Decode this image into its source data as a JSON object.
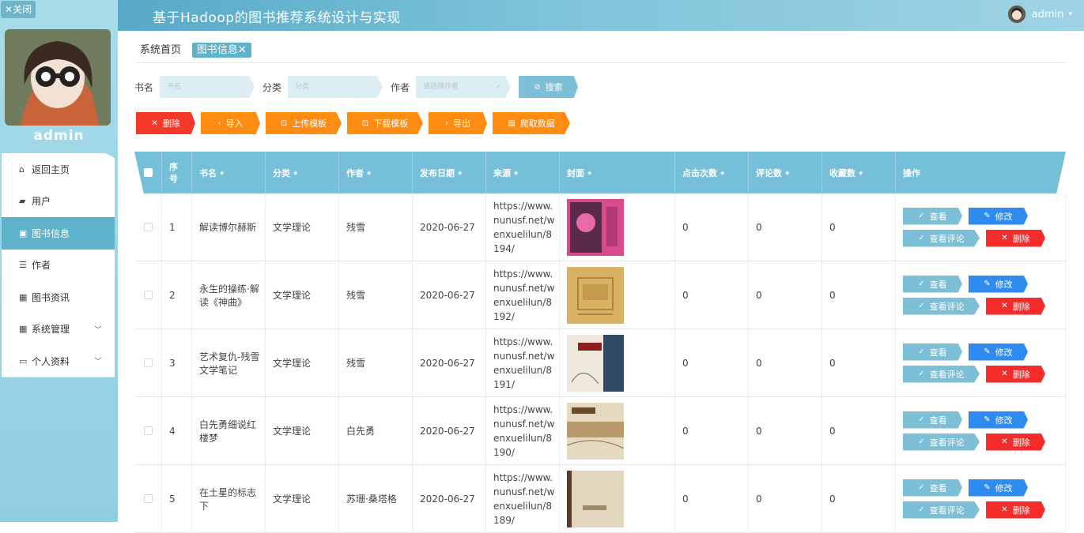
{
  "sidebar": {
    "close_label": "关闭",
    "username": "admin",
    "items": [
      {
        "label": "返回主页",
        "icon": "home-icon"
      },
      {
        "label": "用户",
        "icon": "user-icon"
      },
      {
        "label": "图书信息",
        "icon": "book-icon",
        "active": true
      },
      {
        "label": "作者",
        "icon": "list-icon"
      },
      {
        "label": "图书资讯",
        "icon": "grid-icon"
      },
      {
        "label": "系统管理",
        "icon": "grid-icon",
        "expandable": true
      },
      {
        "label": "个人资料",
        "icon": "card-icon",
        "expandable": true
      }
    ]
  },
  "header": {
    "title": "基于Hadoop的图书推荐系统设计与实现",
    "user": "admin"
  },
  "tabs": [
    {
      "label": "系统首页"
    },
    {
      "label": "图书信息",
      "active": true
    }
  ],
  "search": {
    "name_label": "书名",
    "name_placeholder": "书名",
    "category_label": "分类",
    "category_placeholder": "分类",
    "author_label": "作者",
    "author_placeholder": "请选择作者",
    "search_button": "搜索"
  },
  "actions": {
    "delete": "删除",
    "import": "导入",
    "upload_template": "上传模板",
    "download_template": "下载模板",
    "export": "导出",
    "crawl": "爬取数据"
  },
  "table": {
    "headers": {
      "index": "序号",
      "name": "书名",
      "category": "分类",
      "author": "作者",
      "date": "发布日期",
      "source": "来源",
      "cover": "封面",
      "clicks": "点击次数",
      "comments": "评论数",
      "favorites": "收藏数",
      "ops": "操作"
    },
    "ops": {
      "view": "查看",
      "edit": "修改",
      "view_comments": "查看评论",
      "delete": "删除"
    },
    "rows": [
      {
        "index": "1",
        "name": "解读博尔赫斯",
        "category": "文学理论",
        "author": "残雪",
        "date": "2020-06-27",
        "source": "https://www.nunusf.net/wenxuelilun/8194/",
        "clicks": "0",
        "comments": "0",
        "favorites": "0"
      },
      {
        "index": "2",
        "name": "永生的操练·解读《神曲》",
        "category": "文学理论",
        "author": "残雪",
        "date": "2020-06-27",
        "source": "https://www.nunusf.net/wenxuelilun/8192/",
        "clicks": "0",
        "comments": "0",
        "favorites": "0"
      },
      {
        "index": "3",
        "name": "艺术复仇-残雪文学笔记",
        "category": "文学理论",
        "author": "残雪",
        "date": "2020-06-27",
        "source": "https://www.nunusf.net/wenxuelilun/8191/",
        "clicks": "0",
        "comments": "0",
        "favorites": "0"
      },
      {
        "index": "4",
        "name": "白先勇细说红楼梦",
        "category": "文学理论",
        "author": "白先勇",
        "date": "2020-06-27",
        "source": "https://www.nunusf.net/wenxuelilun/8190/",
        "clicks": "0",
        "comments": "0",
        "favorites": "0"
      },
      {
        "index": "5",
        "name": "在土星的标志下",
        "category": "文学理论",
        "author": "苏珊·桑塔格",
        "date": "2020-06-27",
        "source": "https://www.nunusf.net/wenxuelilun/8189/",
        "clicks": "0",
        "comments": "0",
        "favorites": "0"
      }
    ]
  }
}
